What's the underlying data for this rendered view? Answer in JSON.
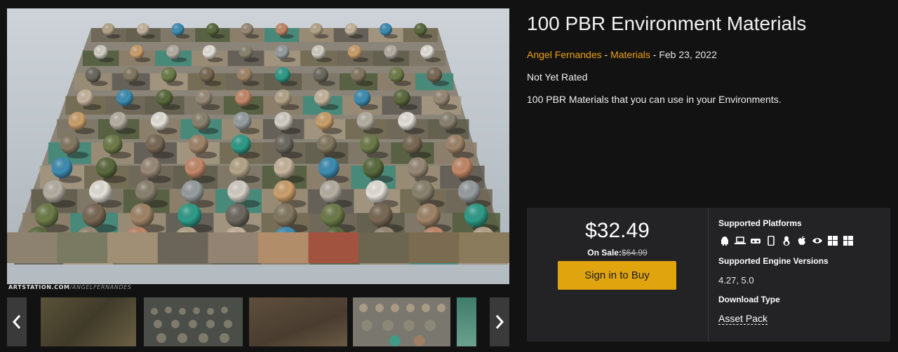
{
  "product": {
    "title": "100 PBR Environment Materials",
    "author": "Angel Fernandes",
    "separator": "-",
    "category": "Materials",
    "date": "Feb 23, 2022",
    "rating": "Not Yet Rated",
    "description": "100 PBR Materials that you can use in your Environments."
  },
  "gallery": {
    "watermark_site": "ARTSTATION.COM",
    "watermark_user": "/ANGELFERNANDES",
    "prev_icon": "chevron-left-icon",
    "next_icon": "chevron-right-icon",
    "thumbnail_count": 5
  },
  "purchase": {
    "price": "$32.49",
    "on_sale_label": "On Sale:",
    "original_price": "$64.99",
    "buy_button": "Sign in to Buy",
    "button_color": "#e0a40f",
    "accent_color": "#f0a312"
  },
  "specs": {
    "platforms_label": "Supported Platforms",
    "platform_icons": [
      "android-icon",
      "laptop-icon",
      "vr-headset-icon",
      "phone-icon",
      "linux-icon",
      "apple-icon",
      "eye-icon",
      "windows-icon",
      "windows-icon"
    ],
    "engine_label": "Supported Engine Versions",
    "engine_versions": "4.27, 5.0",
    "download_label": "Download Type",
    "download_type": "Asset Pack"
  }
}
